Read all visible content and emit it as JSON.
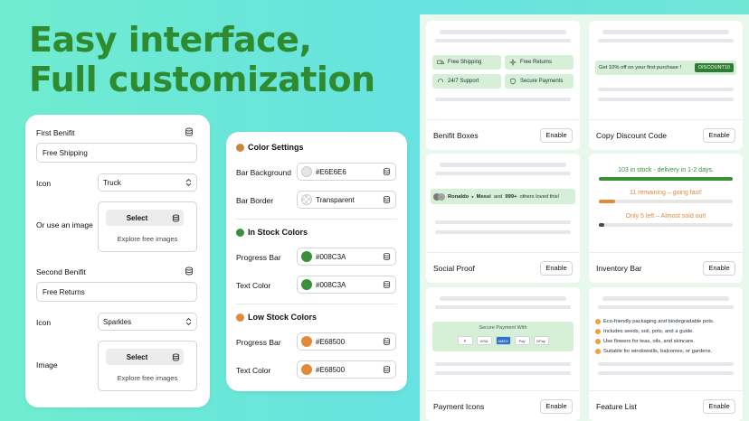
{
  "headline": {
    "line1": "Easy interface,",
    "line2": "Full customization"
  },
  "form": {
    "first_benefit": {
      "label": "First Benifit",
      "value": "Free Shipping",
      "icon_label": "Icon",
      "icon_value": "Truck",
      "image_label": "Or use an image",
      "select": "Select",
      "explore": "Explore free images"
    },
    "second_benefit": {
      "label": "Second Benifit",
      "value": "Free Returns",
      "icon_label": "Icon",
      "icon_value": "Sparkles",
      "image_label": "Image",
      "select": "Select",
      "explore": "Explore free images"
    }
  },
  "colors": {
    "settings_title": "Color Settings",
    "bar_background": {
      "label": "Bar Background",
      "value": "#E6E6E6"
    },
    "bar_border": {
      "label": "Bar Border",
      "value": "Transparent"
    },
    "in_stock_title": "In Stock Colors",
    "in_progress": {
      "label": "Progress Bar",
      "value": "#008C3A"
    },
    "in_text": {
      "label": "Text Color",
      "value": "#008C3A"
    },
    "low_stock_title": "Low Stock Colors",
    "low_progress": {
      "label": "Progress Bar",
      "value": "#E68500"
    },
    "low_text": {
      "label": "Text Color",
      "value": "#E68500"
    },
    "swatches": {
      "bg": "#E6E6E6",
      "green": "#3a8f3a",
      "orange": "#e08a3a"
    }
  },
  "panels": {
    "enable": "Enable",
    "benefit_boxes": {
      "title": "Benifit Boxes",
      "tags": [
        "Free Shipping",
        "Free Returns",
        "24/7 Support",
        "Secure Payments"
      ]
    },
    "discount": {
      "title": "Copy Discount Code",
      "text": "Get 10% off on your first purchase !",
      "code": "DISCOUNT10"
    },
    "social": {
      "title": "Social Proof",
      "names": "Ronaldo",
      "names2": "Messi",
      "and": "and",
      "count": "999+",
      "rest": "others loved this!"
    },
    "inventory": {
      "title": "Inventory Bar",
      "line1": "103 in stock - delivery in 1-2 days.",
      "line2": "11 remaining – going fast!",
      "line3": "Only 5 left – Almost sold out!",
      "fill1": 1.0,
      "fill2": 0.12,
      "fill3": 0.04
    },
    "payment": {
      "title": "Payment Icons",
      "caption": "Secure Payment With",
      "icons": [
        "P",
        "VISA",
        "AMEX",
        "Pay",
        "GPay"
      ]
    },
    "features": {
      "title": "Feature List",
      "items": [
        "Eco-friendly packaging and biodegradable pots.",
        "Includes seeds, soil, pots, and a guide.",
        "Use flowers for teas, oils, and skincare.",
        "Suitable for windowsills, balconies, or gardens."
      ]
    }
  }
}
